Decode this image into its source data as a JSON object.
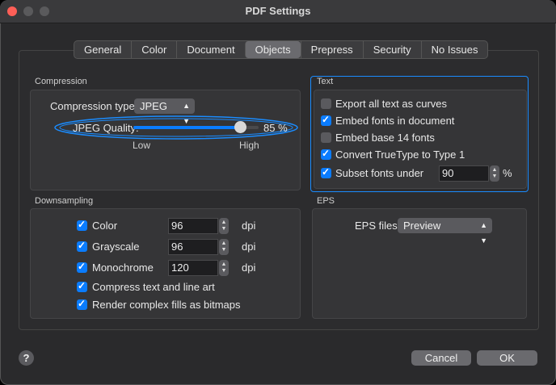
{
  "window": {
    "title": "PDF Settings"
  },
  "tabs": [
    {
      "label": "General"
    },
    {
      "label": "Color"
    },
    {
      "label": "Document"
    },
    {
      "label": "Objects"
    },
    {
      "label": "Prepress"
    },
    {
      "label": "Security"
    },
    {
      "label": "No Issues"
    }
  ],
  "compression": {
    "section_label": "Compression",
    "type_label": "Compression type:",
    "type_value": "JPEG",
    "quality_label": "JPEG Quality:",
    "quality_value": "85 %",
    "quality_fraction": 0.85,
    "low_label": "Low",
    "high_label": "High"
  },
  "text": {
    "section_label": "Text",
    "items": [
      {
        "label": "Export all text as curves",
        "checked": false
      },
      {
        "label": "Embed fonts in document",
        "checked": true
      },
      {
        "label": "Embed base 14 fonts",
        "checked": false
      },
      {
        "label": "Convert TrueType to Type 1",
        "checked": true
      },
      {
        "label": "Subset fonts under",
        "checked": true
      }
    ],
    "subset_value": "90",
    "subset_unit": "%"
  },
  "downsampling": {
    "section_label": "Downsampling",
    "rows": [
      {
        "label": "Color",
        "value": "96",
        "unit": "dpi",
        "checked": true
      },
      {
        "label": "Grayscale",
        "value": "96",
        "unit": "dpi",
        "checked": true
      },
      {
        "label": "Monochrome",
        "value": "120",
        "unit": "dpi",
        "checked": true
      }
    ],
    "compress_label": "Compress text and line art",
    "render_label": "Render complex fills as bitmaps"
  },
  "eps": {
    "section_label": "EPS",
    "files_label": "EPS files:",
    "files_value": "Preview"
  },
  "buttons": {
    "cancel": "Cancel",
    "ok": "OK",
    "help": "?"
  },
  "colors": {
    "accent": "#0a7cff",
    "highlight_border": "#1a8cff"
  }
}
